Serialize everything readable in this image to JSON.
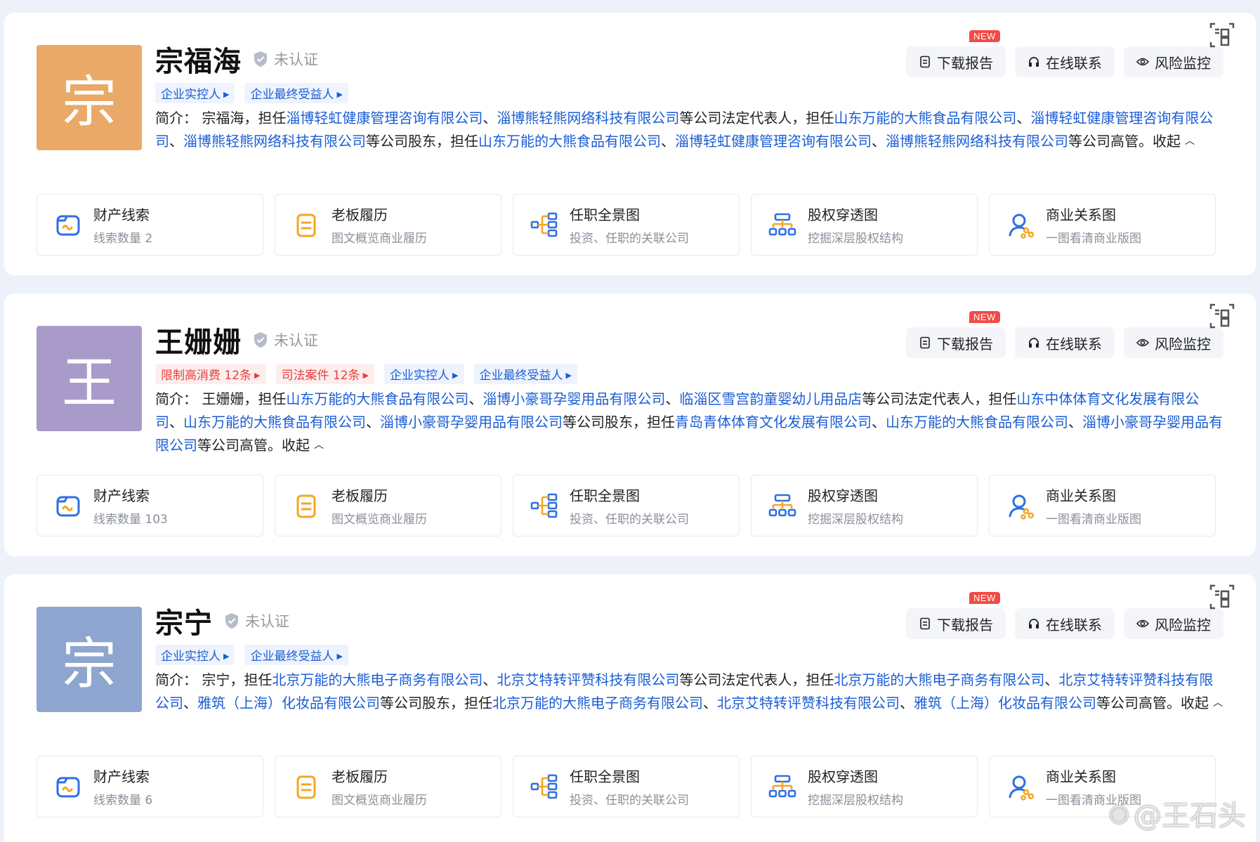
{
  "actions": {
    "download": "下载报告",
    "contact": "在线联系",
    "monitor": "风险监控",
    "new_badge": "NEW"
  },
  "features": [
    {
      "title": "财产线索",
      "icon": "asset-folder-icon"
    },
    {
      "title": "老板履历",
      "sub": "图文概览商业履历",
      "icon": "resume-doc-icon"
    },
    {
      "title": "任职全景图",
      "sub": "投资、任职的关联公司",
      "icon": "org-tree-icon"
    },
    {
      "title": "股权穿透图",
      "sub": "挖掘深层股权结构",
      "icon": "equity-chart-icon"
    },
    {
      "title": "商业关系图",
      "sub": "一图看清商业版图",
      "icon": "relation-person-icon"
    }
  ],
  "verify_text": "未认证",
  "collapse_text": "收起",
  "persons": [
    {
      "avatar_char": "宗",
      "avatar_color": "#eaa968",
      "name": "宗福海",
      "tags": [
        {
          "label": "企业实控人",
          "type": "blue"
        },
        {
          "label": "企业最终受益人",
          "type": "blue"
        }
      ],
      "bio_segments": [
        {
          "t": "简介：  宗福海，担任",
          "link": false
        },
        {
          "t": "淄博轻虹健康管理咨询有限公司",
          "link": true
        },
        {
          "t": "、",
          "link": false
        },
        {
          "t": "淄博熊轻熊网络科技有限公司",
          "link": true
        },
        {
          "t": "等公司法定代表人，担任",
          "link": false
        },
        {
          "t": "山东万能的大熊食品有限公司",
          "link": true
        },
        {
          "t": "、",
          "link": false
        },
        {
          "t": "淄博轻虹健康管理咨询有限公司",
          "link": true
        },
        {
          "t": "、",
          "link": false
        },
        {
          "t": "淄博熊轻熊网络科技有限公司",
          "link": true
        },
        {
          "t": "等公司股东，担任",
          "link": false
        },
        {
          "t": "山东万能的大熊食品有限公司",
          "link": true
        },
        {
          "t": "、",
          "link": false
        },
        {
          "t": "淄博轻虹健康管理咨询有限公司",
          "link": true
        },
        {
          "t": "、",
          "link": false
        },
        {
          "t": "淄博熊轻熊网络科技有限公司",
          "link": true
        },
        {
          "t": "等公司高管。",
          "link": false
        }
      ],
      "asset_clue_count": "线索数量 2"
    },
    {
      "avatar_char": "王",
      "avatar_color": "#a99bc9",
      "name": "王姗姗",
      "tags": [
        {
          "label": "限制高消费 12条",
          "type": "red"
        },
        {
          "label": "司法案件 12条",
          "type": "red"
        },
        {
          "label": "企业实控人",
          "type": "blue"
        },
        {
          "label": "企业最终受益人",
          "type": "blue"
        }
      ],
      "bio_segments": [
        {
          "t": "简介：  王姗姗，担任",
          "link": false
        },
        {
          "t": "山东万能的大熊食品有限公司",
          "link": true
        },
        {
          "t": "、",
          "link": false
        },
        {
          "t": "淄博小豪哥孕婴用品有限公司",
          "link": true
        },
        {
          "t": "、",
          "link": false
        },
        {
          "t": "临淄区雪宫韵童婴幼儿用品店",
          "link": true
        },
        {
          "t": "等公司法定代表人，担任",
          "link": false
        },
        {
          "t": "山东中体体育文化发展有限公司",
          "link": true
        },
        {
          "t": "、",
          "link": false
        },
        {
          "t": "山东万能的大熊食品有限公司",
          "link": true
        },
        {
          "t": "、",
          "link": false
        },
        {
          "t": "淄博小豪哥孕婴用品有限公司",
          "link": true
        },
        {
          "t": "等公司股东，担任",
          "link": false
        },
        {
          "t": "青岛青体体育文化发展有限公司",
          "link": true
        },
        {
          "t": "、",
          "link": false
        },
        {
          "t": "山东万能的大熊食品有限公司",
          "link": true
        },
        {
          "t": "、",
          "link": false
        },
        {
          "t": "淄博小豪哥孕婴用品有限公司",
          "link": true
        },
        {
          "t": "等公司高管。",
          "link": false
        }
      ],
      "asset_clue_count": "线索数量 103"
    },
    {
      "avatar_char": "宗",
      "avatar_color": "#8ea5cf",
      "name": "宗宁",
      "tags": [
        {
          "label": "企业实控人",
          "type": "blue"
        },
        {
          "label": "企业最终受益人",
          "type": "blue"
        }
      ],
      "bio_segments": [
        {
          "t": "简介：  宗宁，担任",
          "link": false
        },
        {
          "t": "北京万能的大熊电子商务有限公司",
          "link": true
        },
        {
          "t": "、",
          "link": false
        },
        {
          "t": "北京艾特转评赞科技有限公司",
          "link": true
        },
        {
          "t": "等公司法定代表人，担任",
          "link": false
        },
        {
          "t": "北京万能的大熊电子商务有限公司",
          "link": true
        },
        {
          "t": "、",
          "link": false
        },
        {
          "t": "北京艾特转评赞科技有限公司",
          "link": true
        },
        {
          "t": "、",
          "link": false
        },
        {
          "t": "雅筑（上海）化妆品有限公司",
          "link": true
        },
        {
          "t": "等公司股东，担任",
          "link": false
        },
        {
          "t": "北京万能的大熊电子商务有限公司",
          "link": true
        },
        {
          "t": "、",
          "link": false
        },
        {
          "t": "北京艾特转评赞科技有限公司",
          "link": true
        },
        {
          "t": "、",
          "link": false
        },
        {
          "t": "雅筑（上海）化妆品有限公司",
          "link": true
        },
        {
          "t": "等公司高管。",
          "link": false
        }
      ],
      "asset_clue_count": "线索数量 6"
    }
  ],
  "watermark": "@王石头"
}
